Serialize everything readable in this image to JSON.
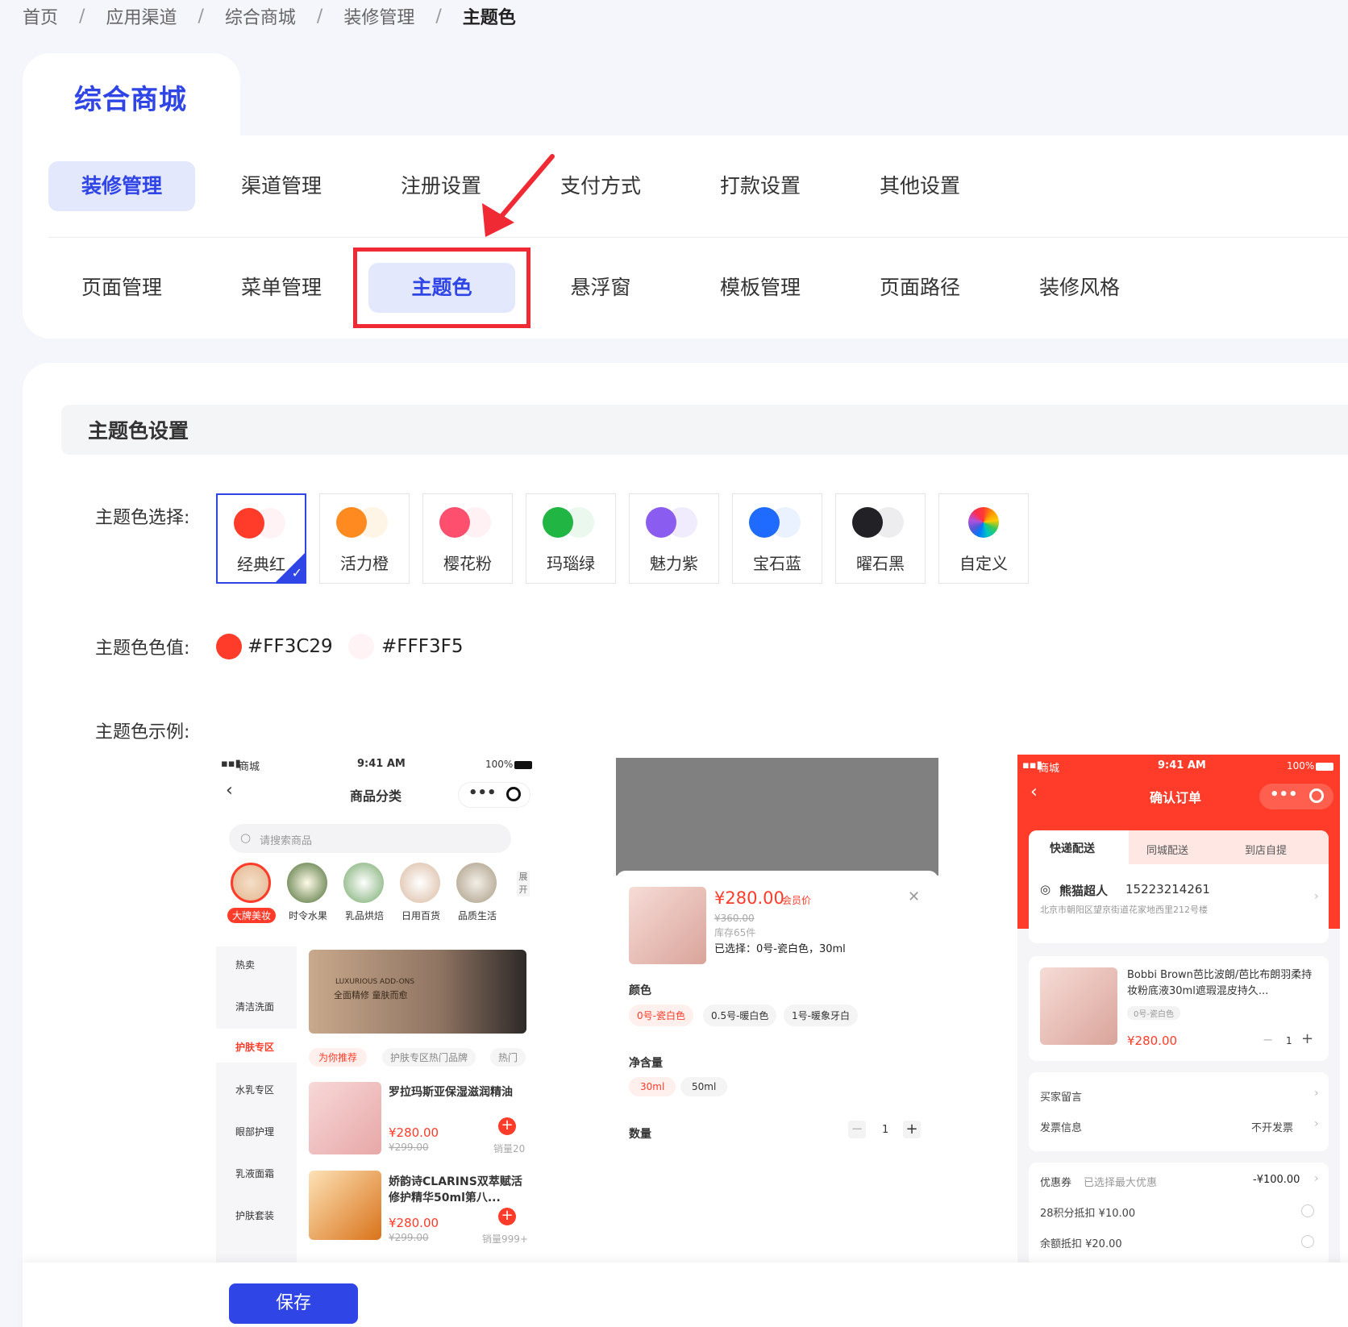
{
  "breadcrumb": [
    "首页",
    "应用渠道",
    "综合商城",
    "装修管理",
    "主题色"
  ],
  "app_title": "综合商城",
  "nav1": [
    "装修管理",
    "渠道管理",
    "注册设置",
    "支付方式",
    "打款设置",
    "其他设置"
  ],
  "nav2": [
    "页面管理",
    "菜单管理",
    "主题色",
    "悬浮窗",
    "模板管理",
    "页面路径",
    "装修风格"
  ],
  "section_title": "主题色设置",
  "labels": {
    "select": "主题色选择:",
    "value": "主题色色值:",
    "example": "主题色示例:"
  },
  "themes": [
    {
      "name": "经典红",
      "c1": "#FF3C29",
      "c2": "#FFF3F5",
      "selected": true
    },
    {
      "name": "活力橙",
      "c1": "#FF8A1F",
      "c2": "#FFF5E6"
    },
    {
      "name": "樱花粉",
      "c1": "#FF4F6E",
      "c2": "#FFF1F4"
    },
    {
      "name": "玛瑙绿",
      "c1": "#21B544",
      "c2": "#EAF8EE"
    },
    {
      "name": "魅力紫",
      "c1": "#8B5CF0",
      "c2": "#F1ECFD"
    },
    {
      "name": "宝石蓝",
      "c1": "#1F6BFF",
      "c2": "#EAF1FF"
    },
    {
      "name": "曜石黑",
      "c1": "#222226",
      "c2": "#EDEDEF"
    },
    {
      "name": "自定义",
      "c1": "",
      "c2": ""
    }
  ],
  "color_values": {
    "primary": "#FF3C29",
    "secondary": "#FFF3F5"
  },
  "phone1": {
    "status_left": "商城",
    "time": "9:41 AM",
    "battery": "100%",
    "title": "商品分类",
    "search_placeholder": "请搜索商品",
    "cats": [
      "大牌美妆",
      "时令水果",
      "乳品烘焙",
      "日用百货",
      "品质生活"
    ],
    "expand": "展开",
    "side": [
      "热卖",
      "清洁洗面",
      "护肤专区",
      "水乳专区",
      "眼部护理",
      "乳液面霜",
      "护肤套装"
    ],
    "banner_l1": "LUXURIOUS ADD-ONS",
    "banner_l2": "全面精修 童肤而愈",
    "tags": [
      "为你推荐",
      "护肤专区热门品牌",
      "热门"
    ],
    "products": [
      {
        "name": "罗拉玛斯亚保湿滋润精油",
        "price": "¥280.00",
        "orig": "¥299.00",
        "sales": "销量20"
      },
      {
        "name": "娇韵诗CLARINS双萃赋活修护精华50ml第八...",
        "price": "¥280.00",
        "orig": "¥299.00",
        "sales": "销量999+"
      }
    ]
  },
  "phone2": {
    "price": "¥280.00",
    "member": "会员价",
    "orig": "¥360.00",
    "stock": "库存65件",
    "selected": "已选择：0号-瓷白色，30ml",
    "color_label": "颜色",
    "colors": [
      "0号-瓷白色",
      "0.5号-暖白色",
      "1号-暖象牙白"
    ],
    "size_label": "净含量",
    "sizes": [
      "30ml",
      "50ml"
    ],
    "qty_label": "数量",
    "qty": "1"
  },
  "phone3": {
    "status_left": "商城",
    "time": "9:41 AM",
    "battery": "100%",
    "title": "确认订单",
    "tabs": [
      "快递配送",
      "同城配送",
      "到店自提"
    ],
    "name": "熊猫超人",
    "phone": "15223214261",
    "address": "北京市朝阳区望京街道花家地西里212号楼",
    "product": "Bobbi Brown芭比波朗/芭比布朗羽柔持妆粉底液30ml遮瑕混皮持久...",
    "spec": "0号-瓷白色",
    "price": "¥280.00",
    "qty": "1",
    "msg": "买家留言",
    "invoice": "发票信息",
    "invoice_val": "不开发票",
    "coupon": "优惠券",
    "coupon_hint": "已选择最大优惠",
    "coupon_val": "-¥100.00",
    "points": "28积分抵扣 ¥10.00",
    "balance": "余额抵扣 ¥20.00"
  },
  "save_label": "保存",
  "accent": "#2F45E6",
  "theme_red": "#FF3C29"
}
